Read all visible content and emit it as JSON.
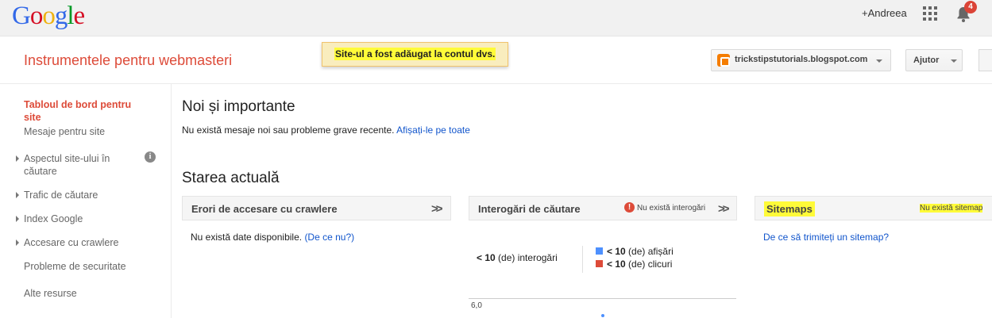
{
  "topbar": {
    "logo_letters": [
      "G",
      "o",
      "o",
      "g",
      "l",
      "e"
    ],
    "user": "+Andreea",
    "notifications_count": "4"
  },
  "header": {
    "title": "Instrumentele pentru webmasteri",
    "notice": "Site-ul a fost adăugat la contul dvs.",
    "site": "trickstipstutorials.blogspot.com",
    "help": "Ajutor"
  },
  "sidebar": {
    "items": [
      {
        "label": "Tabloul de bord pentru site"
      },
      {
        "label": "Mesaje pentru site"
      },
      {
        "label": "Aspectul site-ului în căutare"
      },
      {
        "label": "Trafic de căutare"
      },
      {
        "label": "Index Google"
      },
      {
        "label": "Accesare cu crawlere"
      },
      {
        "label": "Probleme de securitate"
      },
      {
        "label": "Alte resurse"
      }
    ]
  },
  "main": {
    "new_important": {
      "heading": "Noi și importante",
      "message": "Nu există mesaje noi sau probleme grave recente.",
      "link": "Afișați-le pe toate"
    },
    "current_status": {
      "heading": "Starea actuală",
      "crawl_errors": {
        "title": "Erori de accesare cu crawlere",
        "empty": "Nu există date disponibile.",
        "why_link": "(De ce nu?)"
      },
      "search_queries": {
        "title": "Interogări de căutare",
        "note": "Nu există interogări",
        "queries_prefix": "< 10",
        "queries_suffix": "(de) interogări",
        "impressions_prefix": "< 10",
        "impressions_suffix": "(de) afișări",
        "clicks_prefix": "< 10",
        "clicks_suffix": "(de) clicuri",
        "axis_max": "6,0"
      },
      "sitemaps": {
        "title": "Sitemaps",
        "note": "Nu există sitemap",
        "link": "De ce să trimiteți un sitemap?"
      }
    }
  },
  "colors": {
    "accent_red": "#dd4b39",
    "link_blue": "#1155cc",
    "impressions": "#4d90fe",
    "clicks": "#dd4b39",
    "highlight": "#fffb39"
  }
}
